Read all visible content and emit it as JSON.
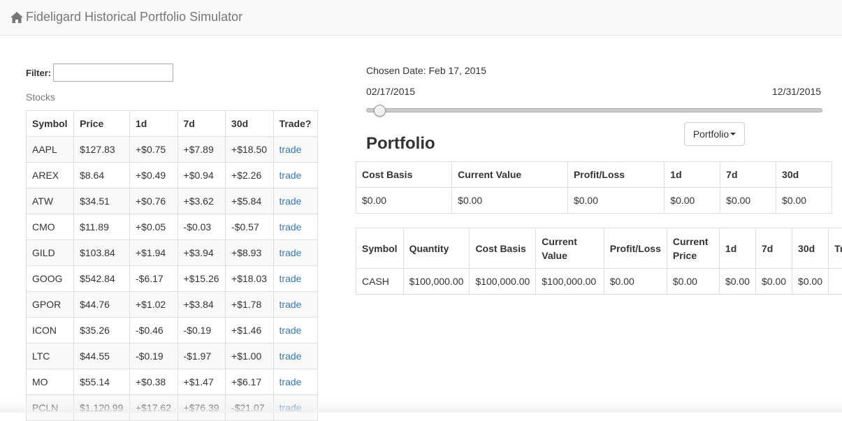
{
  "navbar": {
    "home_icon": "home-icon",
    "title": "Fideligard Historical Portfolio Simulator"
  },
  "filter": {
    "label": "Filter:",
    "value": "",
    "placeholder": ""
  },
  "stocks": {
    "caption": "Stocks",
    "columns": [
      "Symbol",
      "Price",
      "1d",
      "7d",
      "30d",
      "Trade?"
    ],
    "rows": [
      {
        "symbol": "AAPL",
        "price": "$127.83",
        "d1": "+$0.75",
        "d7": "+$7.89",
        "d30": "+$18.50",
        "trade": "trade"
      },
      {
        "symbol": "AREX",
        "price": "$8.64",
        "d1": "+$0.49",
        "d7": "+$0.94",
        "d30": "+$2.26",
        "trade": "trade"
      },
      {
        "symbol": "ATW",
        "price": "$34.51",
        "d1": "+$0.76",
        "d7": "+$3.62",
        "d30": "+$5.84",
        "trade": "trade"
      },
      {
        "symbol": "CMO",
        "price": "$11.89",
        "d1": "+$0.05",
        "d7": "-$0.03",
        "d30": "-$0.57",
        "trade": "trade"
      },
      {
        "symbol": "GILD",
        "price": "$103.84",
        "d1": "+$1.94",
        "d7": "+$3.94",
        "d30": "+$8.93",
        "trade": "trade"
      },
      {
        "symbol": "GOOG",
        "price": "$542.84",
        "d1": "-$6.17",
        "d7": "+$15.26",
        "d30": "+$18.03",
        "trade": "trade"
      },
      {
        "symbol": "GPOR",
        "price": "$44.76",
        "d1": "+$1.02",
        "d7": "+$3.84",
        "d30": "+$1.78",
        "trade": "trade"
      },
      {
        "symbol": "ICON",
        "price": "$35.26",
        "d1": "-$0.46",
        "d7": "-$0.19",
        "d30": "+$1.46",
        "trade": "trade"
      },
      {
        "symbol": "LTC",
        "price": "$44.55",
        "d1": "-$0.19",
        "d7": "-$1.97",
        "d30": "+$1.00",
        "trade": "trade"
      },
      {
        "symbol": "MO",
        "price": "$55.14",
        "d1": "+$0.38",
        "d7": "+$1.47",
        "d30": "+$6.17",
        "trade": "trade"
      },
      {
        "symbol": "PCLN",
        "price": "$1,120.99",
        "d1": "+$17.62",
        "d7": "+$76.39",
        "d30": "-$21.07",
        "trade": "trade"
      }
    ]
  },
  "date_picker": {
    "chosen_label": "Chosen Date: Feb 17, 2015",
    "start": "02/17/2015",
    "end": "12/31/2015",
    "slider_value_fraction": 0.0
  },
  "portfolio": {
    "dropdown_label": "Portfolio",
    "heading": "Portfolio",
    "summary": {
      "columns": [
        "Cost Basis",
        "Current Value",
        "Profit/Loss",
        "1d",
        "7d",
        "30d"
      ],
      "row": [
        "$0.00",
        "$0.00",
        "$0.00",
        "$0.00",
        "$0.00",
        "$0.00"
      ]
    },
    "holdings": {
      "columns": [
        "Symbol",
        "Quantity",
        "Cost Basis",
        "Current Value",
        "Profit/Loss",
        "Current Price",
        "1d",
        "7d",
        "30d",
        "Trade?"
      ],
      "rows": [
        [
          "CASH",
          "$100,000.00",
          "$100,000.00",
          "$100,000.00",
          "$0.00",
          "$0.00",
          "$0.00",
          "$0.00",
          "$0.00",
          ""
        ]
      ]
    }
  },
  "colors": {
    "link": "#337ab7",
    "navbar_bg": "#f8f8f8",
    "navbar_text": "#777777"
  }
}
